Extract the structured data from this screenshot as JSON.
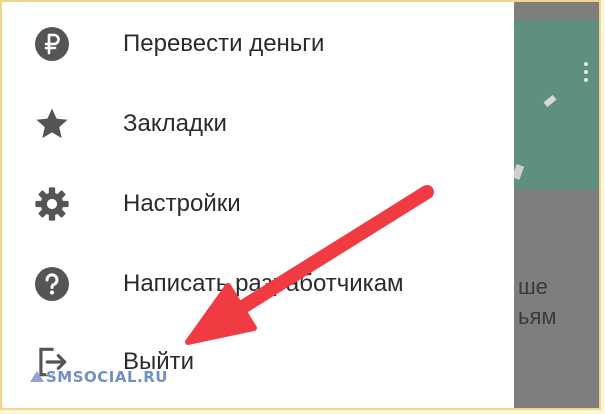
{
  "menu": {
    "items": [
      {
        "label": "Перевести деньги",
        "icon": "ruble-icon"
      },
      {
        "label": "Закладки",
        "icon": "star-icon"
      },
      {
        "label": "Настройки",
        "icon": "gear-icon"
      },
      {
        "label": "Написать разработчикам",
        "icon": "help-icon"
      },
      {
        "label": "Выйти",
        "icon": "logout-icon"
      }
    ]
  },
  "background": {
    "snippet_line1": "ше",
    "snippet_line2": "ьям"
  },
  "watermark": {
    "text": "SMSOCIAL.RU"
  },
  "colors": {
    "icon": "#555555",
    "text": "#2b2b2b",
    "arrow": "#ef3b41",
    "scrim": "#7e7e7e",
    "card": "#5f8f80",
    "page_border": "#f3d58a"
  }
}
